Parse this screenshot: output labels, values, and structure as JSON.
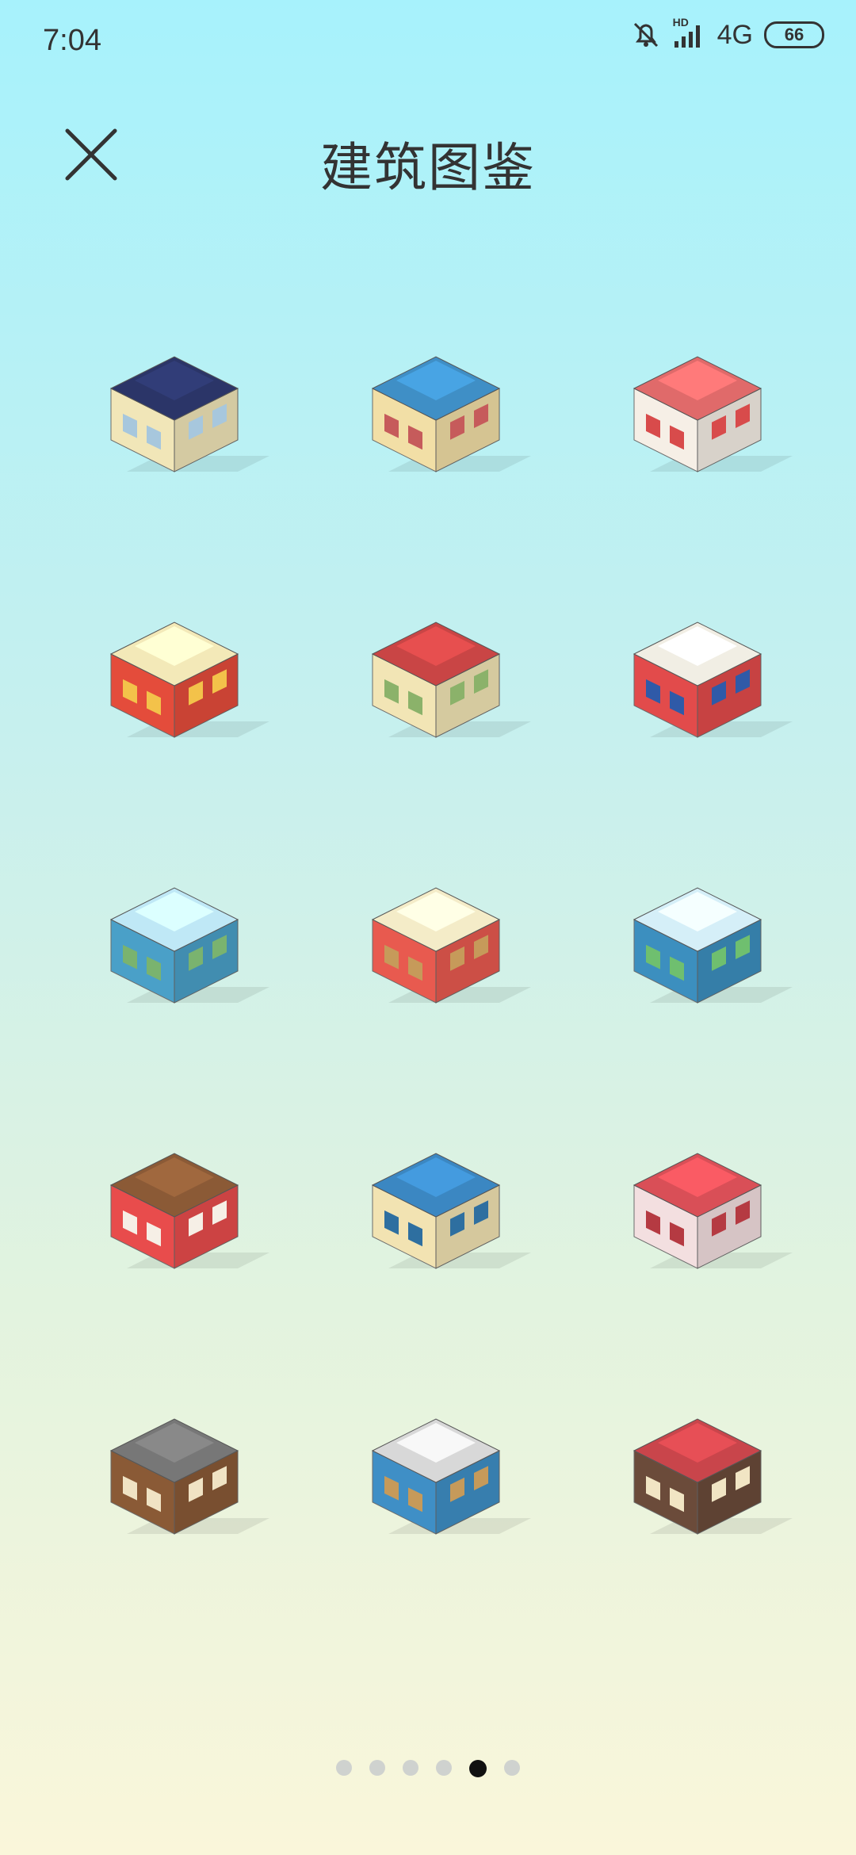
{
  "status_bar": {
    "time": "7:04",
    "network": "4G",
    "hd_label": "HD",
    "battery": "66",
    "icons": [
      "bell-off-icon",
      "signal-icon",
      "battery-icon"
    ]
  },
  "header": {
    "title": "建筑图鉴",
    "close_icon": "close-icon"
  },
  "buildings": [
    {
      "id": "post-office",
      "colors": [
        "#2b3568",
        "#f1e6b8",
        "#a7c7dd"
      ]
    },
    {
      "id": "blue-roof-house",
      "colors": [
        "#3f8fc6",
        "#f2dfa6",
        "#c65b5b"
      ]
    },
    {
      "id": "cafe",
      "colors": [
        "#e06a6a",
        "#f6efe6",
        "#d84b4b"
      ]
    },
    {
      "id": "fast-food",
      "colors": [
        "#f3e9b8",
        "#e44c3b",
        "#f3c24a"
      ]
    },
    {
      "id": "clock-tower",
      "colors": [
        "#c94545",
        "#f2e5b5",
        "#8bb26a"
      ]
    },
    {
      "id": "gas-station",
      "colors": [
        "#f1eee4",
        "#e24b4b",
        "#2f5aa8"
      ]
    },
    {
      "id": "greenhouse",
      "colors": [
        "#bfe8f6",
        "#4aa0c8",
        "#7ab36f"
      ]
    },
    {
      "id": "food-truck",
      "colors": [
        "#f4ecc8",
        "#e85a4f",
        "#c69a5a"
      ]
    },
    {
      "id": "glass-tower",
      "colors": [
        "#d5eff8",
        "#3c8fbf",
        "#6fbf6f"
      ]
    },
    {
      "id": "restaurant",
      "colors": [
        "#8b5a36",
        "#e84c4c",
        "#f6efe6"
      ]
    },
    {
      "id": "police-station",
      "colors": [
        "#3b87c2",
        "#f2e3b2",
        "#2e6fa0"
      ]
    },
    {
      "id": "fire-station",
      "colors": [
        "#d94f57",
        "#f3dfe0",
        "#b53a42"
      ]
    },
    {
      "id": "ramen-shop",
      "colors": [
        "#777777",
        "#8a5a36",
        "#f0e3c4"
      ]
    },
    {
      "id": "parking-garage",
      "colors": [
        "#d8d8d8",
        "#3f8fc6",
        "#c69a5a"
      ]
    },
    {
      "id": "farm-barn",
      "colors": [
        "#c9454b",
        "#6b4b3a",
        "#f1e5c4"
      ]
    }
  ],
  "pagination": {
    "total": 6,
    "active": 5
  }
}
